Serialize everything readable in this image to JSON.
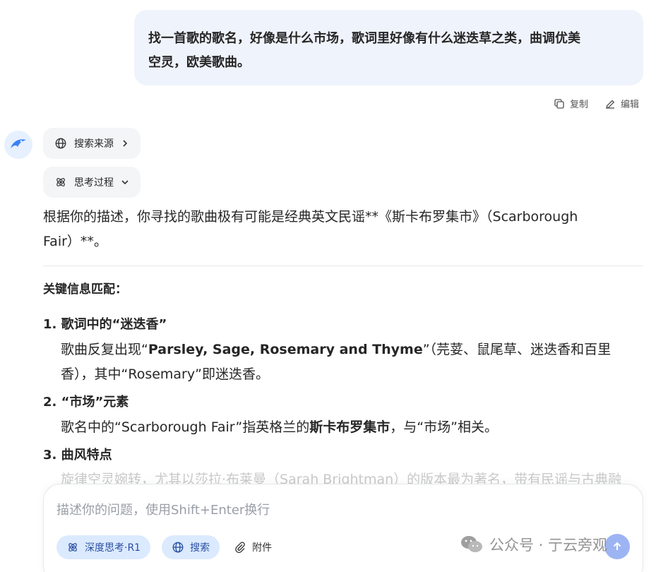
{
  "user_message": {
    "line1": "找一首歌的歌名，好像是什么市场，歌词里好像有什么迷迭草之类，曲调优美",
    "line2": "空灵，欧美歌曲。"
  },
  "message_actions": {
    "copy": "复制",
    "edit": "编辑"
  },
  "chips": {
    "sources": "搜索来源",
    "thinking": "思考过程"
  },
  "answer": {
    "intro_line1": "根据你的描述，你寻找的歌曲极有可能是经典英文民谣**《斯卡布罗集市》（Scarborough",
    "intro_line2": "Fair）**。",
    "section_title": "关键信息匹配：",
    "items": [
      {
        "head": "1. 歌词中的“迷迭香”",
        "body_pre": "歌曲反复出现“",
        "body_bold": "Parsley, Sage, Rosemary and Thyme",
        "body_post": "”（芫荽、鼠尾草、迷迭香和百里",
        "body_line2": "香），其中“Rosemary”即迷迭香。"
      },
      {
        "head": "2. “市场”元素",
        "body_pre": "歌名中的“Scarborough Fair”指英格兰的",
        "body_bold": "斯卡布罗集市",
        "body_post": "，与“市场”相关。"
      },
      {
        "head": "3. 曲风特点",
        "body_faded": "旋律空灵婉转，尤其以莎拉·布莱曼（Sarah Brightman）的版本最为著名，带有民谣与古典融"
      }
    ]
  },
  "input": {
    "placeholder": "描述你的问题，使用Shift+Enter换行",
    "deep_think": "深度思考·R1",
    "search": "搜索",
    "attach": "附件"
  },
  "watermark": {
    "text": "公众号 · 亍云旁观"
  },
  "colors": {
    "accent": "#2a4fa3",
    "pill_bg": "#dbeafe",
    "bubble_bg": "#eff3fb"
  }
}
